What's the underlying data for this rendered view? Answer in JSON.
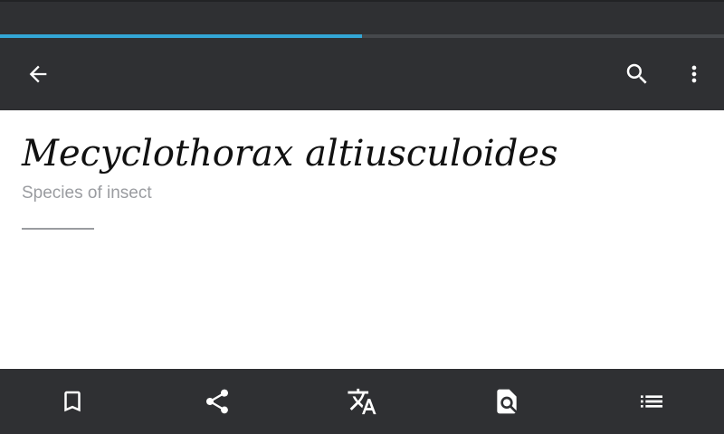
{
  "article": {
    "title": "Mecyclothorax altiusculoides",
    "description": "Species of insect"
  },
  "page_load_progress": 0.5,
  "toolbar": {
    "back_icon": "arrow-back-icon",
    "search_icon": "search-icon",
    "overflow_icon": "more-vert-icon"
  },
  "bottom_bar": {
    "items": [
      {
        "icon": "bookmark-icon"
      },
      {
        "icon": "share-icon"
      },
      {
        "icon": "translate-icon"
      },
      {
        "icon": "find-in-page-icon"
      },
      {
        "icon": "list-icon"
      }
    ]
  },
  "colors": {
    "bar_background": "#2f3033",
    "progress_accent": "#33a6d6",
    "title_text": "#111111",
    "description_text": "#9a9ca0"
  }
}
